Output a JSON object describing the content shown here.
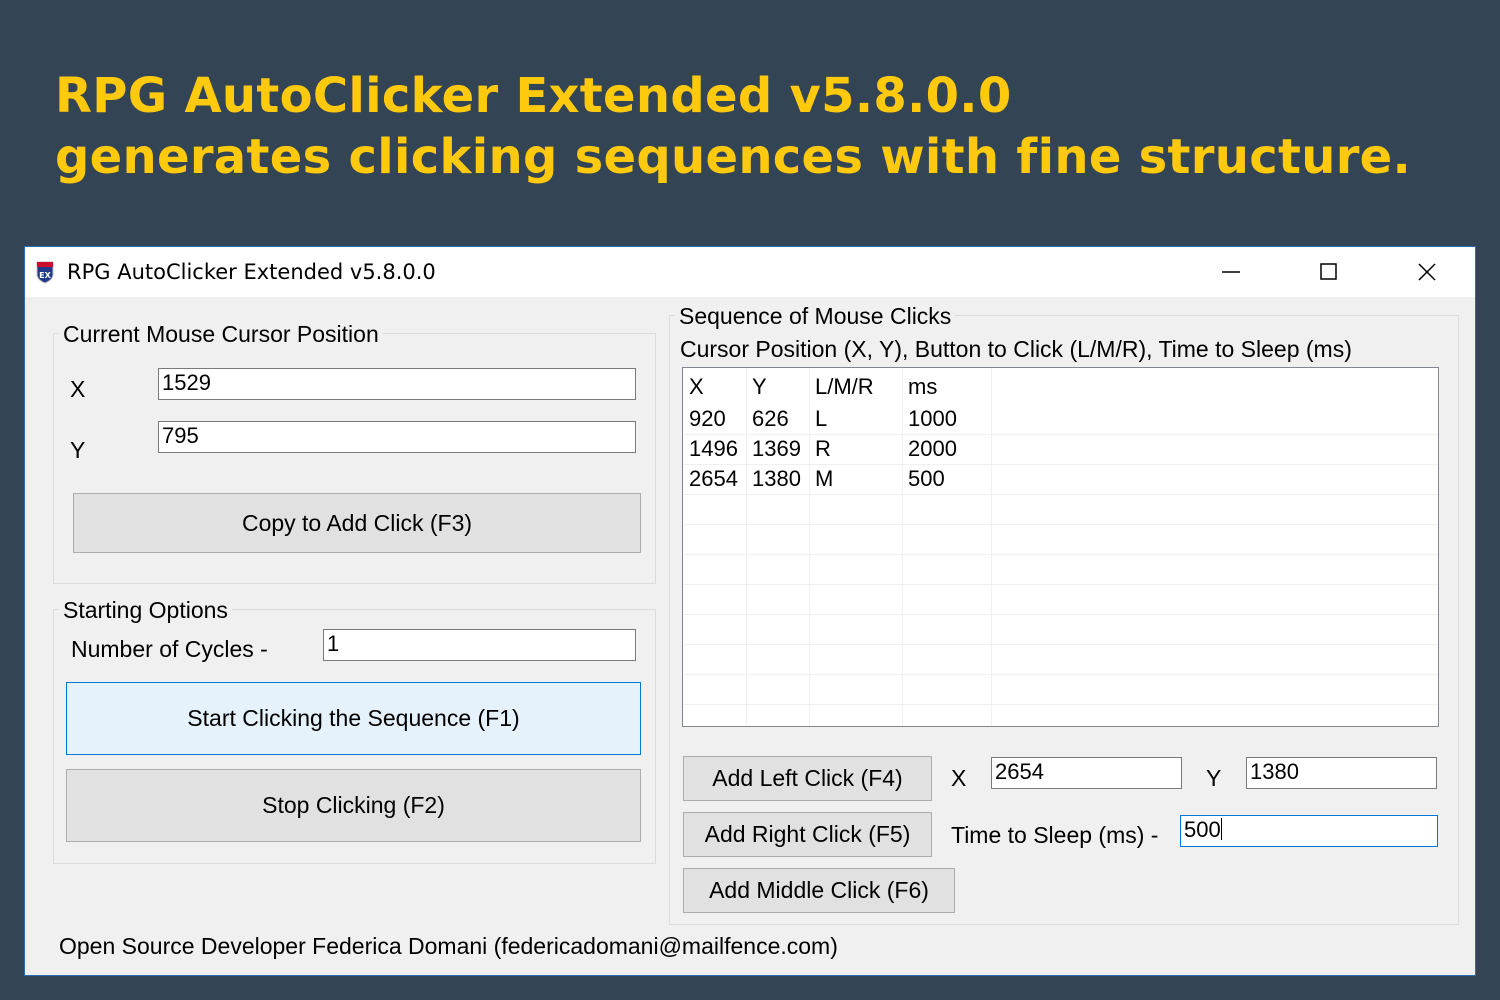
{
  "banner": {
    "line1": "RPG AutoClicker Extended v5.8.0.0",
    "line2": "generates clicking sequences with fine structure."
  },
  "window": {
    "title": "RPG AutoClicker Extended v5.8.0.0",
    "icon": "app-logo-icon",
    "controls": [
      "minimize-icon",
      "maximize-icon",
      "close-icon"
    ]
  },
  "cursor_group": {
    "title": "Current Mouse Cursor Position",
    "x_label": "X",
    "x_value": "1529",
    "y_label": "Y",
    "y_value": "795",
    "copy_button": "Copy to Add Click (F3)"
  },
  "start_group": {
    "title": "Starting Options",
    "cycles_label": "Number of Cycles -",
    "cycles_value": "1",
    "start_button": "Start Clicking the Sequence (F1)",
    "stop_button": "Stop Clicking (F2)"
  },
  "sequence_group": {
    "title": "Sequence of Mouse Clicks",
    "subtitle": "Cursor Position (X, Y), Button to Click (L/M/R), Time to Sleep (ms)",
    "columns": [
      "X",
      "Y",
      "L/M/R",
      "ms"
    ],
    "rows": [
      [
        "920",
        "626",
        "L",
        "1000"
      ],
      [
        "1496",
        "1369",
        "R",
        "2000"
      ],
      [
        "2654",
        "1380",
        "M",
        "500"
      ]
    ],
    "add_left_button": "Add Left Click (F4)",
    "add_right_button": "Add Right Click (F5)",
    "add_middle_button": "Add Middle Click (F6)",
    "x_label": "X",
    "x_value": "2654",
    "y_label": "Y",
    "y_value": "1380",
    "sleep_label": "Time to Sleep (ms) -",
    "sleep_value": "500"
  },
  "footer": "Open Source Developer Federica Domani (federicadomani@mailfence.com)",
  "colors": {
    "background": "#334455",
    "headline": "#ffc90e",
    "accent": "#0078d7"
  }
}
